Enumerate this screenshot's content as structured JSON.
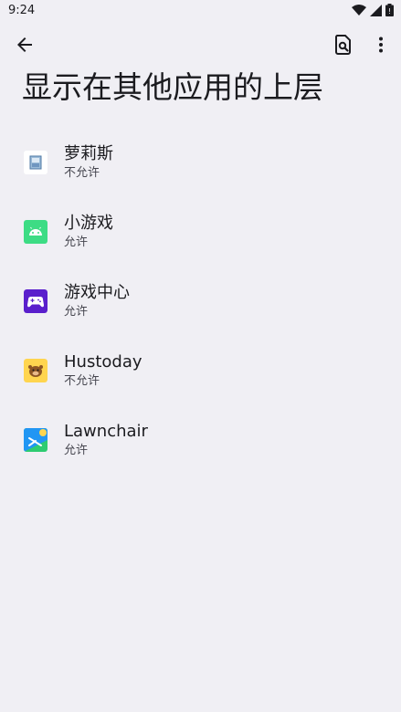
{
  "status_bar": {
    "time": "9:24",
    "icons": [
      "wifi-icon",
      "signal-icon",
      "battery-icon"
    ]
  },
  "app_bar": {
    "icons": [
      "back-arrow-icon",
      "search-in-page-icon",
      "more-vert-icon"
    ]
  },
  "page": {
    "title": "显示在其他应用的上层"
  },
  "apps": [
    {
      "name": "萝莉斯",
      "status": "不允许",
      "icon": "app-icon-loris"
    },
    {
      "name": "小游戏",
      "status": "允许",
      "icon": "android-icon"
    },
    {
      "name": "游戏中心",
      "status": "允许",
      "icon": "gamepad-icon"
    },
    {
      "name": "Hustoday",
      "status": "不允许",
      "icon": "app-icon-hustoday"
    },
    {
      "name": "Lawnchair",
      "status": "允许",
      "icon": "app-icon-lawnchair"
    }
  ],
  "colors": {
    "background": "#f0eff4",
    "text": "#1b1b1f",
    "subtext": "#46464f"
  }
}
